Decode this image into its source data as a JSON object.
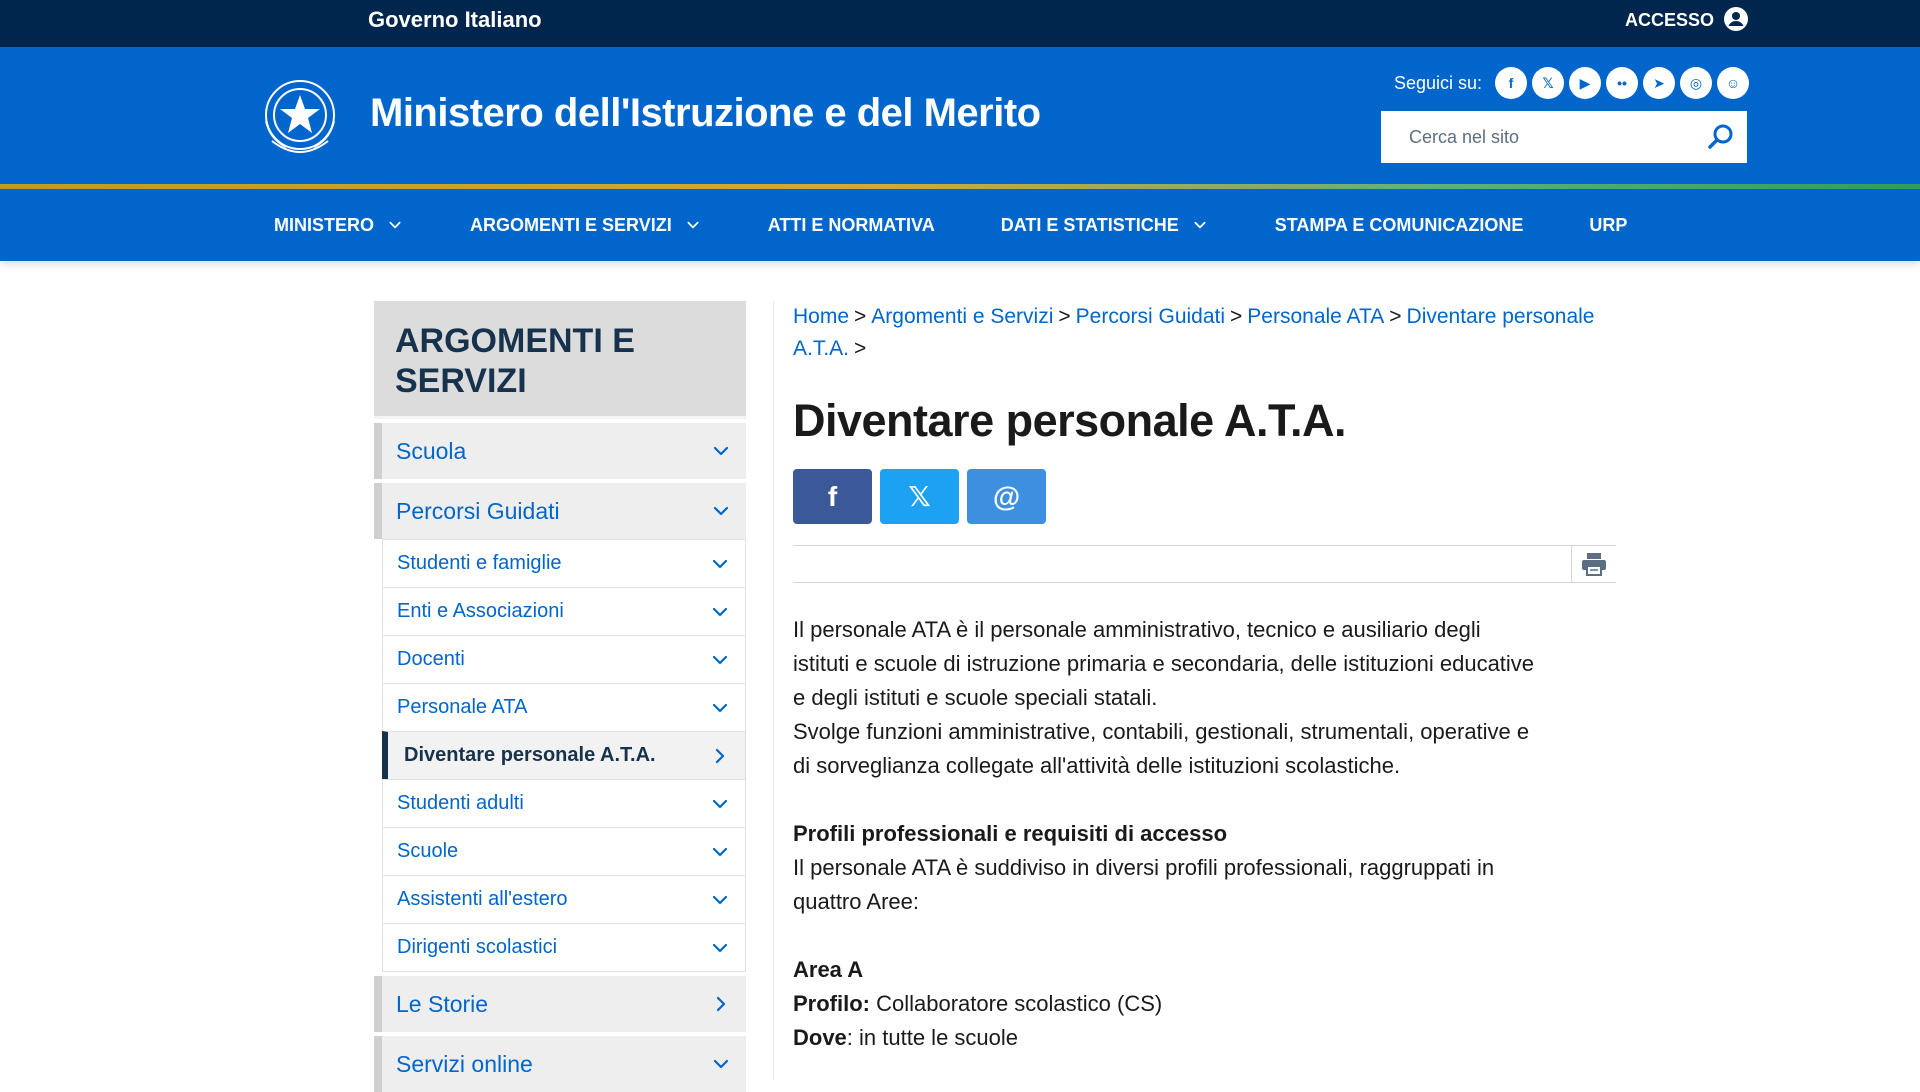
{
  "gov_bar": {
    "name": "Governo Italiano",
    "access_label": "ACCESSO"
  },
  "header": {
    "title": "Ministero dell'Istruzione e del Merito",
    "follow_label": "Seguici su:",
    "social": [
      {
        "name": "facebook-icon",
        "glyph": "f"
      },
      {
        "name": "x-twitter-icon",
        "glyph": "𝕏"
      },
      {
        "name": "youtube-icon",
        "glyph": "▶"
      },
      {
        "name": "flickr-icon",
        "glyph": "••"
      },
      {
        "name": "telegram-icon",
        "glyph": "➤"
      },
      {
        "name": "instagram-icon",
        "glyph": "◎"
      },
      {
        "name": "slideshare-icon",
        "glyph": "☺"
      }
    ],
    "search_placeholder": "Cerca nel sito"
  },
  "nav": {
    "items": [
      {
        "label": "MINISTERO",
        "dropdown": true
      },
      {
        "label": "ARGOMENTI E SERVIZI",
        "dropdown": true
      },
      {
        "label": "ATTI E NORMATIVA",
        "dropdown": false
      },
      {
        "label": "DATI E STATISTICHE",
        "dropdown": true
      },
      {
        "label": "STAMPA E COMUNICAZIONE",
        "dropdown": false
      },
      {
        "label": "URP",
        "dropdown": false
      }
    ]
  },
  "sidebar": {
    "title": "ARGOMENTI E SERVIZI",
    "sections": [
      {
        "label": "Scuola",
        "chevron": "down",
        "children": []
      },
      {
        "label": "Percorsi Guidati",
        "chevron": "down",
        "children": [
          {
            "label": "Studenti e famiglie",
            "chevron": "down",
            "active": false
          },
          {
            "label": "Enti e Associazioni",
            "chevron": "down",
            "active": false
          },
          {
            "label": "Docenti",
            "chevron": "down",
            "active": false
          },
          {
            "label": "Personale ATA",
            "chevron": "down",
            "active": false
          },
          {
            "label": "Diventare personale A.T.A.",
            "chevron": "right",
            "active": true
          },
          {
            "label": "Studenti adulti",
            "chevron": "down",
            "active": false
          },
          {
            "label": "Scuole",
            "chevron": "down",
            "active": false
          },
          {
            "label": "Assistenti all'estero",
            "chevron": "down",
            "active": false
          },
          {
            "label": "Dirigenti scolastici",
            "chevron": "down",
            "active": false
          }
        ]
      },
      {
        "label": "Le Storie",
        "chevron": "right",
        "children": []
      },
      {
        "label": "Servizi online",
        "chevron": "down",
        "children": []
      }
    ]
  },
  "breadcrumb": [
    "Home",
    "Argomenti e Servizi",
    "Percorsi Guidati",
    "Personale ATA",
    "Diventare personale A.T.A."
  ],
  "breadcrumb_sep": ">",
  "page": {
    "title": "Diventare personale A.T.A.",
    "share": [
      {
        "name": "share-facebook-button",
        "glyph": "f",
        "color": "#3b5998"
      },
      {
        "name": "share-x-button",
        "glyph": "𝕏",
        "color": "#1da1f2"
      },
      {
        "name": "share-email-button",
        "glyph": "@",
        "color": "#3d8fe0"
      }
    ],
    "intro_lines": [
      "Il personale ATA è il personale amministrativo, tecnico e ausiliario degli",
      "istituti e scuole di istruzione primaria e secondaria, delle istituzioni educative",
      "e degli istituti e scuole speciali statali.",
      "Svolge funzioni amministrative, contabili, gestionali, strumentali, operative e",
      "di sorveglianza collegate all'attività delle istituzioni scolastiche."
    ],
    "profiles_heading": "Profili professionali e requisiti di accesso",
    "profiles_lines": [
      "Il personale ATA è suddiviso in diversi profili professionali, raggruppati in",
      "quattro Aree:"
    ],
    "area_a": {
      "heading": "Area A",
      "profile_label": "Profilo:",
      "profile_value": " Collaboratore scolastico (CS)",
      "where_label": "Dove",
      "where_value": ": in tutte le scuole"
    }
  },
  "colors": {
    "gov_bar": "#00264d",
    "brand_blue": "#0066cc",
    "dark_text": "#17324d"
  }
}
